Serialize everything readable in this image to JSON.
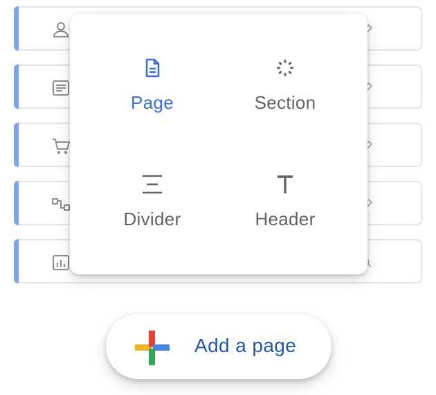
{
  "background_list": {
    "items": [
      {
        "icon": "contacts-icon"
      },
      {
        "icon": "document-lines-icon"
      },
      {
        "icon": "cart-icon"
      },
      {
        "icon": "flow-icon"
      },
      {
        "icon": "analytics-icon"
      }
    ],
    "accent_color": "#7fa4ee"
  },
  "insert_menu": {
    "options": [
      {
        "label": "Page",
        "icon": "page-icon",
        "selected": true
      },
      {
        "label": "Section",
        "icon": "section-icon",
        "selected": false
      },
      {
        "label": "Divider",
        "icon": "divider-icon",
        "selected": false
      },
      {
        "label": "Header",
        "icon": "header-icon",
        "selected": false
      }
    ],
    "selected_color": "#3b6fd4"
  },
  "add_button": {
    "label": "Add a page",
    "icon": "google-plus-icon"
  }
}
